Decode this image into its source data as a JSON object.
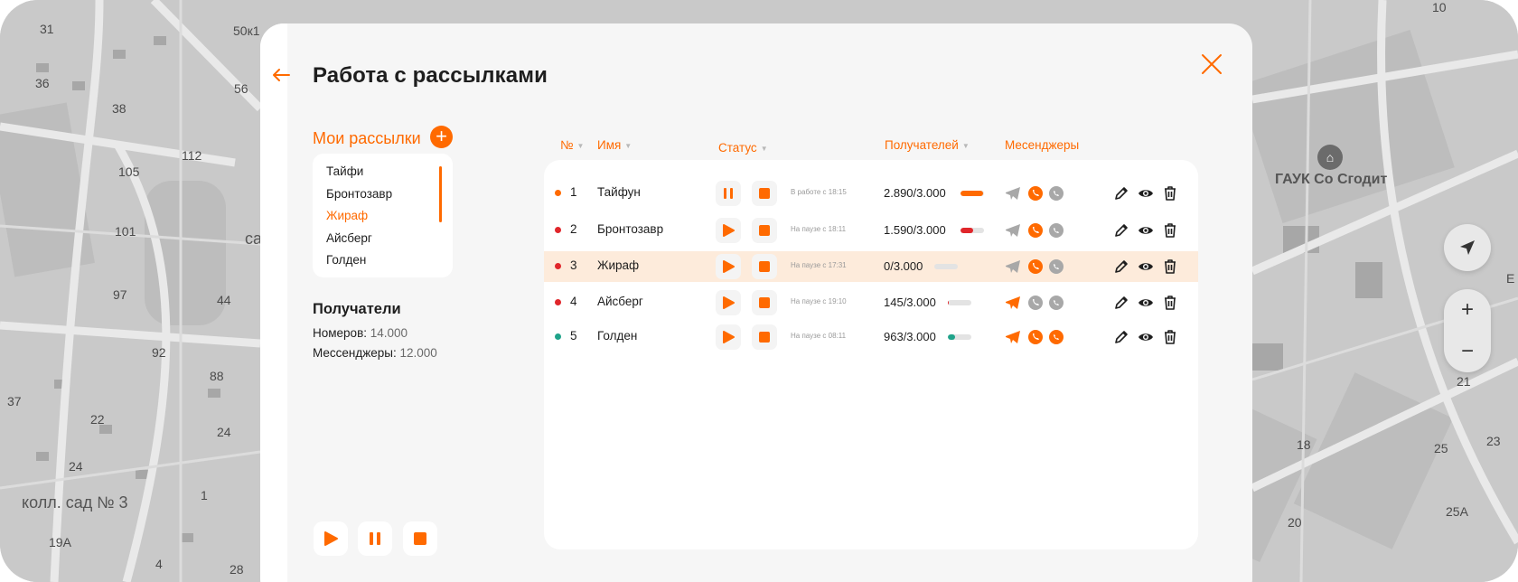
{
  "map": {
    "labels": [
      "31",
      "50к1",
      "36",
      "38",
      "56",
      "105",
      "112",
      "101",
      "са",
      "97",
      "44",
      "92",
      "88",
      "37",
      "22",
      "24",
      "24",
      "1",
      "колл. сад № 3",
      "19А",
      "4",
      "28",
      "18",
      "25",
      "23",
      "21",
      "20",
      "25А",
      "Е",
      "10"
    ],
    "poi_label": "ГАУК Со Сгодит",
    "zoom_in": "+",
    "zoom_out": "−"
  },
  "modal": {
    "title": "Работа с рассылками"
  },
  "sidebar": {
    "heading": "Мои рассылки",
    "add_label": "+",
    "items": [
      {
        "label": "Тайфи",
        "active": false
      },
      {
        "label": "Бронтозавр",
        "active": false
      },
      {
        "label": "Жираф",
        "active": true
      },
      {
        "label": "Айсберг",
        "active": false
      },
      {
        "label": "Голден",
        "active": false
      }
    ],
    "recipients_title": "Получатели",
    "numbers_label": "Номеров:",
    "numbers_value": "14.000",
    "messengers_label": "Мессенджеры:",
    "messengers_value": "12.000"
  },
  "table": {
    "headers": {
      "num": "№",
      "name": "Имя",
      "status": "Статус",
      "recipients": "Получателей",
      "messengers": "Месенджеры"
    },
    "rows": [
      {
        "num": "1",
        "name": "Тайфун",
        "dot_color": "#ff6a00",
        "running": true,
        "status": "В работе с 18:15",
        "count": "2.890/3.000",
        "progress": 0.96,
        "bar_color": "#ff6a00",
        "telegram": false,
        "viber": true,
        "whatsapp": false,
        "highlight": false
      },
      {
        "num": "2",
        "name": "Бронтозавр",
        "dot_color": "#e0262b",
        "running": false,
        "status": "На паузе с 18:11",
        "count": "1.590/3.000",
        "progress": 0.53,
        "bar_color": "#e0262b",
        "telegram": false,
        "viber": true,
        "whatsapp": false,
        "highlight": false
      },
      {
        "num": "3",
        "name": "Жираф",
        "dot_color": "#e0262b",
        "running": false,
        "status": "На паузе с 17:31",
        "count": "0/3.000",
        "progress": 0,
        "bar_color": "#e0262b",
        "telegram": false,
        "viber": true,
        "whatsapp": false,
        "highlight": true
      },
      {
        "num": "4",
        "name": "Айсберг",
        "dot_color": "#e0262b",
        "running": false,
        "status": "На паузе с 19:10",
        "count": "145/3.000",
        "progress": 0.05,
        "bar_color": "#e0262b",
        "telegram": true,
        "viber": false,
        "whatsapp": false,
        "highlight": false
      },
      {
        "num": "5",
        "name": "Голден",
        "dot_color": "#1fa38a",
        "running": false,
        "status": "На паузе с 08:11",
        "count": "963/3.000",
        "progress": 0.32,
        "bar_color": "#1fa38a",
        "telegram": true,
        "viber": true,
        "whatsapp": true,
        "highlight": false
      }
    ]
  },
  "colors": {
    "accent": "#ff6a00",
    "inactive_icon": "#a8a8a8",
    "row_highlight": "#fdebdb"
  },
  "icons": [
    "back-arrow-icon",
    "close-icon",
    "plus-icon",
    "play-icon",
    "pause-icon",
    "stop-icon",
    "telegram-icon",
    "viber-icon",
    "whatsapp-icon",
    "pencil-icon",
    "eye-icon",
    "trash-icon",
    "navigation-arrow-icon"
  ]
}
